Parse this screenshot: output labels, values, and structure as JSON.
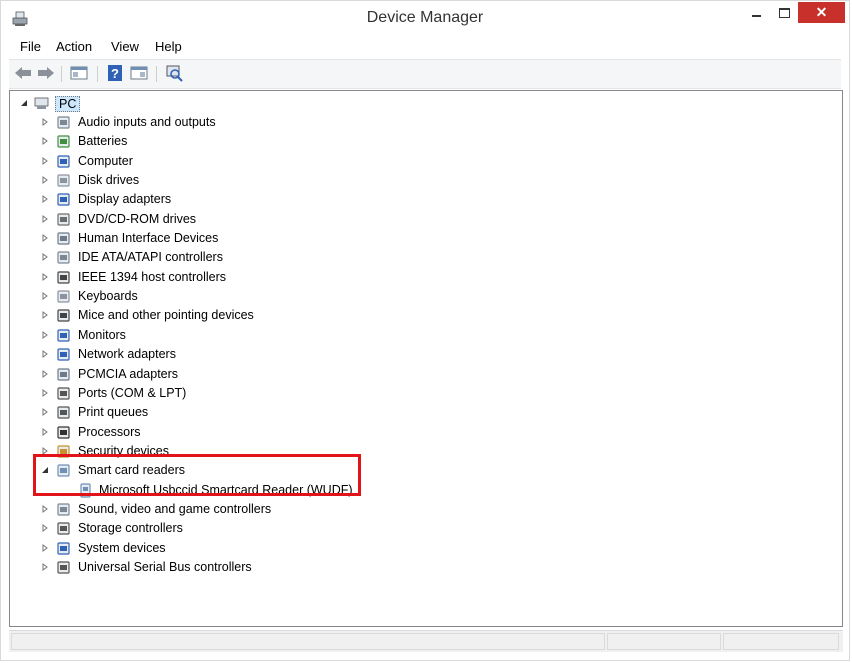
{
  "window": {
    "title": "Device Manager"
  },
  "menubar": {
    "items": [
      "File",
      "Action",
      "View",
      "Help"
    ]
  },
  "toolbar": {
    "buttons": [
      "back-icon",
      "forward-icon",
      "properties-view-icon",
      "help-icon",
      "action-view-icon",
      "scan-hardware-icon"
    ]
  },
  "tree": {
    "root": "PC",
    "categories": [
      {
        "label": "Audio inputs and outputs",
        "icon": "speaker-icon"
      },
      {
        "label": "Batteries",
        "icon": "battery-icon"
      },
      {
        "label": "Computer",
        "icon": "computer-icon"
      },
      {
        "label": "Disk drives",
        "icon": "disk-drive-icon"
      },
      {
        "label": "Display adapters",
        "icon": "display-adapter-icon"
      },
      {
        "label": "DVD/CD-ROM drives",
        "icon": "dvd-drive-icon"
      },
      {
        "label": "Human Interface Devices",
        "icon": "hid-icon"
      },
      {
        "label": "IDE ATA/ATAPI controllers",
        "icon": "ide-controller-icon"
      },
      {
        "label": "IEEE 1394 host controllers",
        "icon": "ieee1394-icon"
      },
      {
        "label": "Keyboards",
        "icon": "keyboard-icon"
      },
      {
        "label": "Mice and other pointing devices",
        "icon": "mouse-icon"
      },
      {
        "label": "Monitors",
        "icon": "monitor-icon"
      },
      {
        "label": "Network adapters",
        "icon": "network-adapter-icon"
      },
      {
        "label": "PCMCIA adapters",
        "icon": "pcmcia-icon"
      },
      {
        "label": "Ports (COM & LPT)",
        "icon": "port-icon"
      },
      {
        "label": "Print queues",
        "icon": "printer-icon"
      },
      {
        "label": "Processors",
        "icon": "processor-icon"
      },
      {
        "label": "Security devices",
        "icon": "security-device-icon"
      },
      {
        "label": "Smart card readers",
        "icon": "smart-card-reader-icon",
        "expanded": true,
        "children": [
          {
            "label": "Microsoft Usbccid Smartcard Reader (WUDF)",
            "icon": "smart-card-reader-icon"
          }
        ]
      },
      {
        "label": "Sound, video and game controllers",
        "icon": "sound-icon"
      },
      {
        "label": "Storage controllers",
        "icon": "storage-icon"
      },
      {
        "label": "System devices",
        "icon": "system-device-icon"
      },
      {
        "label": "Universal Serial Bus controllers",
        "icon": "usb-icon"
      }
    ]
  },
  "colors": {
    "highlight": "#e3131a",
    "close_button": "#c7302b"
  }
}
